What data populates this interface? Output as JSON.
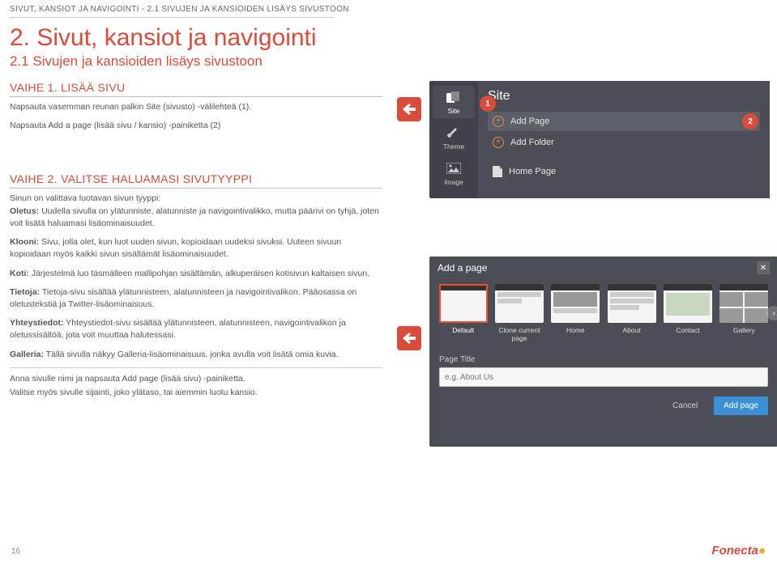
{
  "breadcrumb": "SIVUT, KANSIOT JA NAVIGOINTI  -  2.1 Sivujen ja kansioiden lisäys sivustoon",
  "title": "2. Sivut, kansiot ja navigointi",
  "subtitle": "2.1 Sivujen ja kansioiden lisäys sivustoon",
  "page_number": "16",
  "footer_brand": "Fonecta",
  "step1": {
    "heading": "VAIHE 1. LISÄÄ SIVU",
    "line1": "Napsauta vasemman reunan palkin Site (sivusto) -välilehteä (1).",
    "line2": "Napsauta Add a page (lisää sivu / kansio) -painiketta (2)"
  },
  "step2": {
    "heading": "VAIHE 2. VALITSE HALUAMASI SIVUTYYPPI",
    "intro": "Sinun on valittava luotavan sivun tyyppi:",
    "oletus_label": "Oletus:",
    "oletus_text": " Uudella sivulla on ylätunniste, alatunniste ja navigointivalikko, mutta päärivi on tyhjä, joten voit lisätä haluamasi lisäominaisuudet.",
    "klooni_label": "Klooni:",
    "klooni_text": " Sivu, jolla olet, kun luot uuden sivun, kopioidaan uudeksi sivuksi. Uuteen sivuun kopioidaan myös kaikki sivun sisältämät lisäominaisuudet.",
    "koti_label": "Koti:",
    "koti_text": " Järjestelmä luo täsmälleen mallipohjan sisältämän, alkuperäisen kotisivun kaltaisen sivun.",
    "tietoja_label": "Tietoja:",
    "tietoja_text": " Tietoja-sivu sisältää ylätunnisteen, alatunnisteen ja navigointivalikon. Pääosassa on oletustekstiä ja Twitter-lisäominaisuus.",
    "yhteys_label": "Yhteystiedot:",
    "yhteys_text": " Yhteystiedot-sivu sisältää ylätunnisteen, alatunnisteen, navigointivalikon ja oletussisältöä, jota voit muuttaa halutessasi.",
    "galleria_label": "Galleria:",
    "galleria_text": " Tällä sivulla näkyy Galleria-lisäominaisuus, jonka avulla voit lisätä omia kuvia.",
    "closing1": "Anna sivulle nimi ja napsauta Add page (lisää sivu) -painiketta.",
    "closing2": "Valitse myös sivulle sijainti, joko ylätaso, tai aiemmin luotu kansio."
  },
  "callouts": {
    "c1": "1",
    "c2": "2"
  },
  "shot1": {
    "tab_site": "Site",
    "tab_theme": "Theme",
    "tab_image": "Image",
    "panel_title": "Site",
    "add_page": "Add Page",
    "add_folder": "Add Folder",
    "home_page": "Home Page"
  },
  "shot2": {
    "header": "Add a page",
    "templates": [
      {
        "label": "Default"
      },
      {
        "label": "Clone current page"
      },
      {
        "label": "Home"
      },
      {
        "label": "About"
      },
      {
        "label": "Contact"
      },
      {
        "label": "Gallery"
      }
    ],
    "form_label": "Page Title",
    "placeholder": "e.g. About Us",
    "cancel": "Cancel",
    "add_page": "Add page"
  }
}
